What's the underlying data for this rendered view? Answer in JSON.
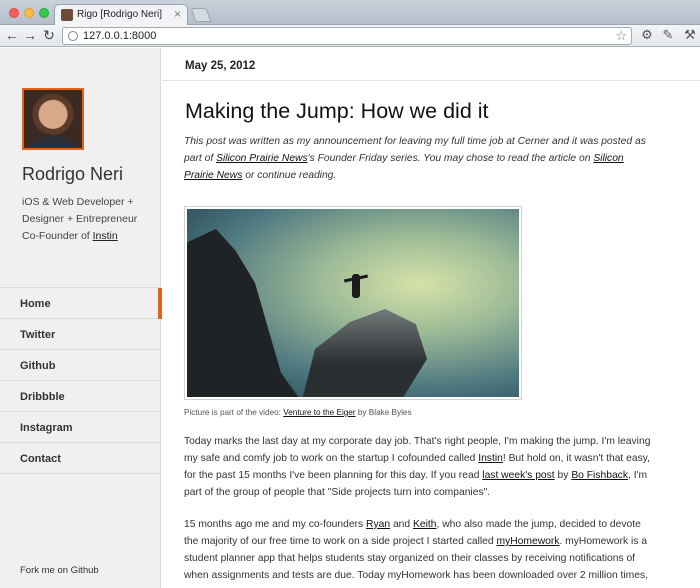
{
  "browser": {
    "tab_title": "Rigo [Rodrigo Neri]",
    "tab_close": "×",
    "url": "127.0.0.1:8000",
    "back": "←",
    "forward": "→",
    "reload": "↻",
    "star": "☆"
  },
  "sidebar": {
    "name": "Rodrigo Neri",
    "bio_line1": "iOS & Web Developer +",
    "bio_line2": "Designer + Entrepreneur",
    "bio_line3_prefix": "Co-Founder of",
    "bio_line3_link": "Instin",
    "nav": [
      {
        "label": "Home",
        "active": true
      },
      {
        "label": "Twitter"
      },
      {
        "label": "Github"
      },
      {
        "label": "Dribbble"
      },
      {
        "label": "Instagram"
      },
      {
        "label": "Contact"
      }
    ],
    "fork_label": "Fork me on Github",
    "accent_color": "#e4621a"
  },
  "post": {
    "date": "May 25, 2012",
    "title": "Making the Jump: How we did it",
    "intro": {
      "t1": "This post was written as my announcement for leaving my full time job at Cerner and it was posted as part of",
      "link1": "Silicon Prairie News",
      "t2": "'s Founder Friday series. You may chose to read the article on",
      "link2": "Silicon Prairie News",
      "t3": "or continue reading."
    },
    "caption": {
      "prefix": "Picture is part of the video:",
      "link": "Venture to the Eiger",
      "suffix": "by Blake Byles"
    },
    "para1": {
      "t1": "Today marks the last day at my corporate day job. That's right people, I'm making the jump. I'm leaving my safe and comfy job to work on the startup I cofounded called",
      "link1": "Instin",
      "t2": "! But hold on, it wasn't that easy, for the past 15 months I've been planning for this day. If you read",
      "link2": "last week's post",
      "t3": "by",
      "link3": "Bo Fishback",
      "t4": ", I'm part of the group of people that \"Side projects turn into companies\"."
    },
    "para2": {
      "t1": "15 months ago me and my co-founders",
      "link1": "Ryan",
      "t2": "and",
      "link2": "Keith",
      "t3": ", who also made the jump, decided to devote the majority of our free time to work on a side project I started called",
      "link3": "myHomework",
      "t4": ". myHomework is a student planner app that helps students stay organized on their classes by receiving notifications of when assignments and tests are due. Today myHomework has been downloaded over 2 million times,"
    }
  }
}
